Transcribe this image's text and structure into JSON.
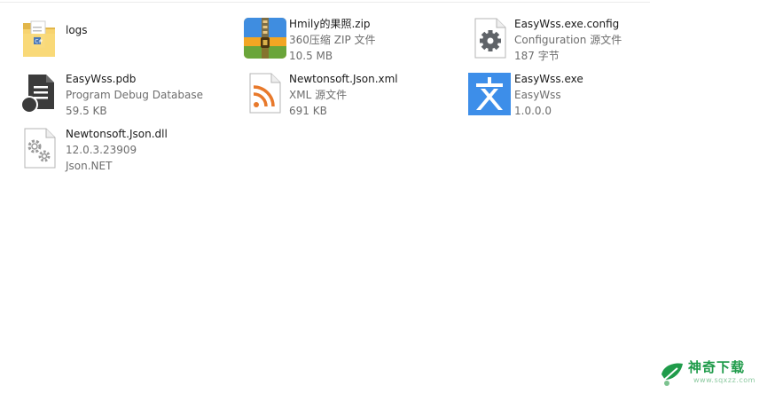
{
  "files": [
    {
      "name": "logs",
      "lines": [],
      "icon": "folder-icon"
    },
    {
      "name": "Hmily的果照.zip",
      "lines": [
        "360压缩 ZIP 文件",
        "10.5 MB"
      ],
      "icon": "zip-archive-icon"
    },
    {
      "name": "EasyWss.exe.config",
      "lines": [
        "Configuration 源文件",
        "187 字节"
      ],
      "icon": "config-gear-icon"
    },
    {
      "name": "EasyWss.pdb",
      "lines": [
        "Program Debug Database",
        "59.5 KB"
      ],
      "icon": "pdb-file-icon"
    },
    {
      "name": "Newtonsoft.Json.xml",
      "lines": [
        "XML 源文件",
        "691 KB"
      ],
      "icon": "xml-rss-icon"
    },
    {
      "name": "EasyWss.exe",
      "lines": [
        "EasyWss",
        "1.0.0.0"
      ],
      "icon": "easywss-app-icon"
    },
    {
      "name": "Newtonsoft.Json.dll",
      "lines": [
        "12.0.3.23909",
        "Json.NET"
      ],
      "icon": "dll-gears-icon"
    }
  ],
  "watermark": {
    "title": "神奇下载",
    "url": "www.sqxzz.com",
    "color": "#1f9b4a"
  },
  "colors": {
    "name_text": "#1a1a1a",
    "detail_text": "#6d6d6d",
    "app_icon_bg": "#3d8ee9"
  }
}
